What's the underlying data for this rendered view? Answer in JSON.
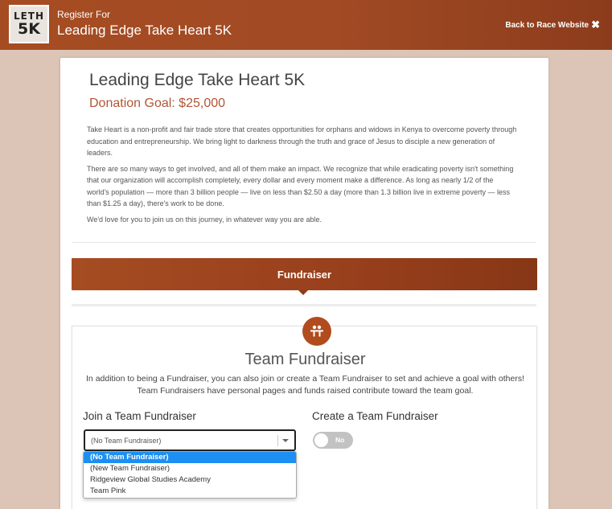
{
  "header": {
    "logo_line1": "LETH",
    "logo_line2": "5K",
    "register_for": "Register For",
    "race_title": "Leading Edge Take Heart 5K",
    "back_link": "Back to Race Website",
    "close_glyph": "✖"
  },
  "event": {
    "name": "Leading Edge Take Heart 5K",
    "goal": "Donation Goal: $25,000",
    "paragraphs": [
      "Take Heart is a non-profit and fair trade store that creates opportunities for orphans and widows in Kenya to overcome poverty through education and entrepreneurship. We bring light to darkness through the truth and grace of Jesus to disciple a new generation of leaders.",
      "There are so many ways to get involved, and all of them make an impact. We recognize that while eradicating poverty isn't something that our organization will accomplish completely, every dollar and every moment make a difference. As long as nearly 1/2 of the world's population — more than 3 billion people — live on less than $2.50 a day (more than 1.3 billion live in extreme poverty — less than $1.25 a day), there's work to be done.",
      "We'd love for you to join us on this journey, in whatever way you are able."
    ]
  },
  "fundraiser_tab": {
    "label": "Fundraiser"
  },
  "team": {
    "icon": "team-icon",
    "title": "Team Fundraiser",
    "description": "In addition to being a Fundraiser, you can also join or create a Team Fundraiser to set and achieve a goal with others! Team Fundraisers have personal pages and funds raised contribute toward the team goal.",
    "join_label": "Join a Team Fundraiser",
    "create_label": "Create a Team Fundraiser",
    "select_value": "(No Team Fundraiser)",
    "toggle_label": "No",
    "options": [
      "(No Team Fundraiser)",
      "(New Team Fundraiser)",
      "Ridgeview Global Studies Academy",
      "Team Pink"
    ]
  },
  "colors": {
    "brand": "#a64c22",
    "goal_text": "#b25534",
    "highlight": "#1e8ff2"
  }
}
